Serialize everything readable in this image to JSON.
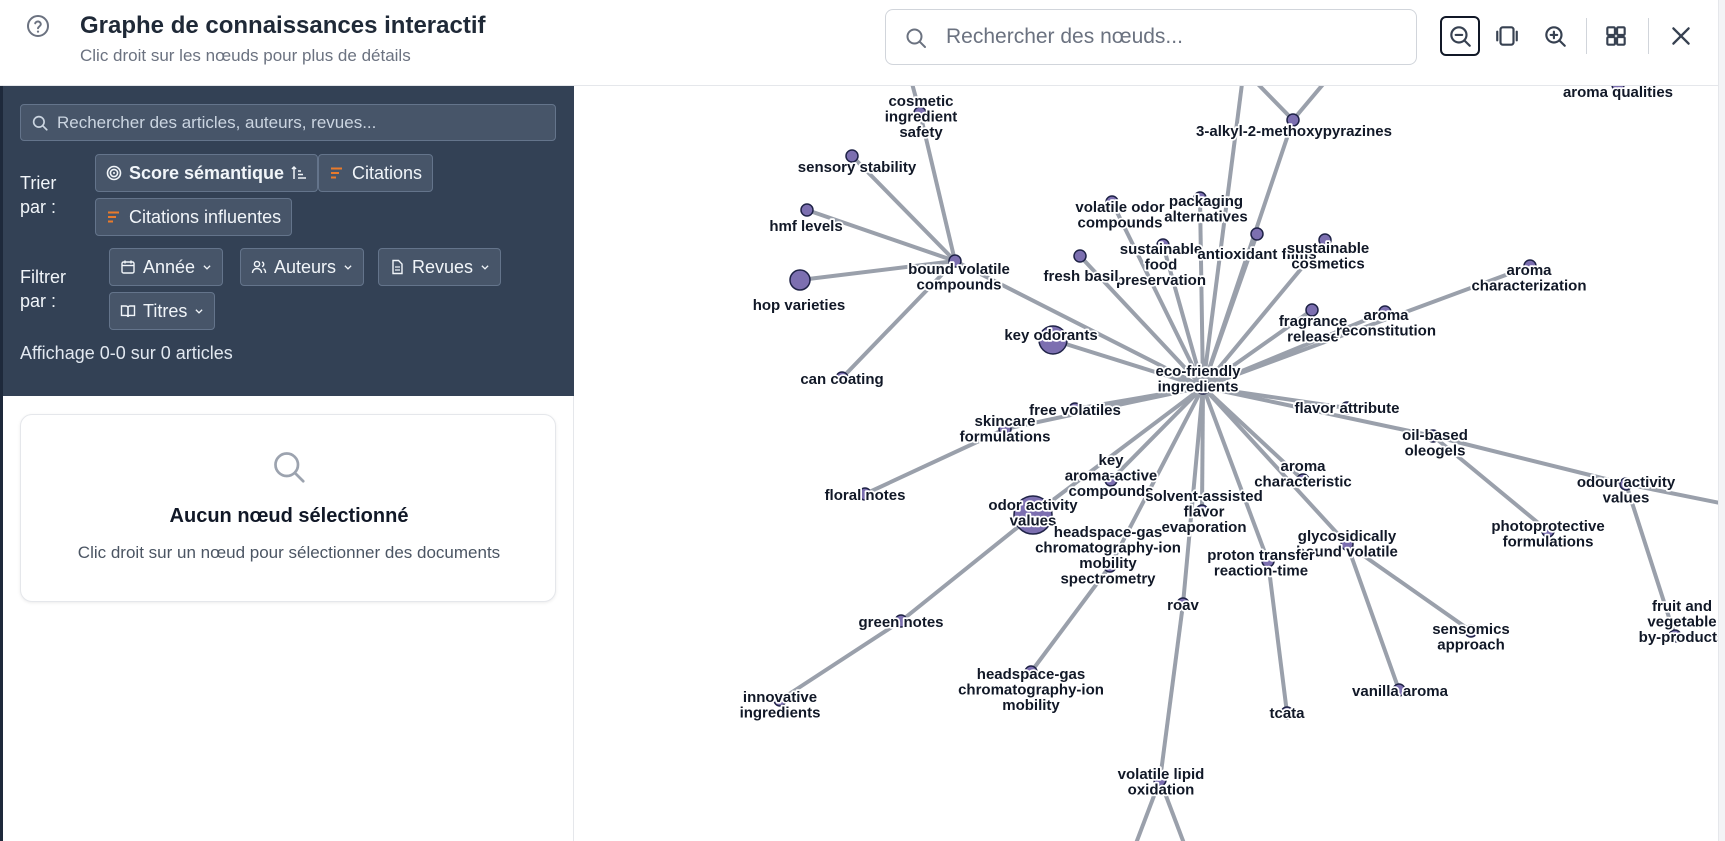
{
  "header": {
    "title": "Graphe de connaissances interactif",
    "subtitle": "Clic droit sur les nœuds pour plus de détails",
    "search_placeholder": "Rechercher des nœuds...",
    "tools": [
      "zoom-out-icon",
      "fit-view-icon",
      "zoom-in-icon",
      "layout-grid-icon",
      "close-icon"
    ]
  },
  "sidebar": {
    "search_placeholder": "Rechercher des articles, auteurs, revues...",
    "sort_label": "Trier par :",
    "sort_options": [
      "Score sémantique",
      "Citations",
      "Citations influentes"
    ],
    "filter_label": "Filtrer par :",
    "filter_options": [
      "Année",
      "Auteurs",
      "Revues",
      "Titres"
    ],
    "count_text": "Affichage 0-0 sur 0 articles"
  },
  "empty_state": {
    "title": "Aucun nœud sélectionné",
    "text": "Clic droit sur un nœud pour sélectionner des documents"
  },
  "colors": {
    "node_fill": "#7c6fb0",
    "node_stroke": "#1f2347",
    "edge": "#9aa0ab",
    "panel_dark": "#334155",
    "accent_orange": "#ea7a2b"
  },
  "graph": {
    "nodes": [
      {
        "id": "n0",
        "lines": [
          "eco-friendly",
          "ingredients"
        ]
      },
      {
        "id": "n1",
        "lines": [
          "cosmetic",
          "ingredient",
          "safety"
        ]
      },
      {
        "id": "n2",
        "lines": [
          "sensory stability"
        ]
      },
      {
        "id": "n3",
        "lines": [
          "hmf levels"
        ]
      },
      {
        "id": "n4",
        "lines": [
          "bound volatile",
          "compounds"
        ]
      },
      {
        "id": "n5",
        "lines": [
          "hop varieties"
        ]
      },
      {
        "id": "n6",
        "lines": [
          "can coating"
        ]
      },
      {
        "id": "n7",
        "lines": [
          "3-alkyl-2-methoxypyrazines"
        ]
      },
      {
        "id": "n8",
        "lines": [
          "aroma qualities"
        ]
      },
      {
        "id": "n9",
        "lines": [
          "volatile odor",
          "compounds"
        ]
      },
      {
        "id": "n10",
        "lines": [
          "packaging",
          "alternatives"
        ]
      },
      {
        "id": "n11",
        "lines": [
          "sustainable",
          "food",
          "preservation"
        ]
      },
      {
        "id": "n12",
        "lines": [
          "antioxidant films"
        ]
      },
      {
        "id": "n13",
        "lines": [
          "sustainable",
          "cosmetics"
        ]
      },
      {
        "id": "n14",
        "lines": [
          "fresh basil"
        ]
      },
      {
        "id": "n15",
        "lines": [
          "aroma",
          "characterization"
        ]
      },
      {
        "id": "n16",
        "lines": [
          "key odorants"
        ]
      },
      {
        "id": "n17",
        "lines": [
          "fragrance",
          "release"
        ]
      },
      {
        "id": "n18",
        "lines": [
          "aroma",
          "reconstitution"
        ]
      },
      {
        "id": "n19",
        "lines": [
          "free volatiles"
        ]
      },
      {
        "id": "n20",
        "lines": [
          "flavor attribute"
        ]
      },
      {
        "id": "n21",
        "lines": [
          "skincare",
          "formulations"
        ]
      },
      {
        "id": "n22",
        "lines": [
          "oil-based",
          "oleogels"
        ]
      },
      {
        "id": "n23",
        "lines": [
          "key",
          "aroma-active",
          "compounds"
        ]
      },
      {
        "id": "n24",
        "lines": [
          "aroma",
          "characteristic"
        ]
      },
      {
        "id": "n25",
        "lines": [
          "odour activity",
          "values"
        ]
      },
      {
        "id": "n26",
        "lines": [
          "floral notes"
        ]
      },
      {
        "id": "n27",
        "lines": [
          "odor activity",
          "values"
        ]
      },
      {
        "id": "n28",
        "lines": [
          "solvent-assisted",
          "flavor",
          "evaporation"
        ]
      },
      {
        "id": "n29",
        "lines": [
          "headspace-gas",
          "chromatography-ion",
          "mobility",
          "spectrometry"
        ]
      },
      {
        "id": "n30",
        "lines": [
          "glycosidically",
          "bound volatile"
        ]
      },
      {
        "id": "n31",
        "lines": [
          "proton transfer",
          "reaction-time"
        ]
      },
      {
        "id": "n32",
        "lines": [
          "photoprotective",
          "formulations"
        ]
      },
      {
        "id": "n33",
        "lines": [
          "roav"
        ]
      },
      {
        "id": "n34",
        "lines": [
          "green notes"
        ]
      },
      {
        "id": "n35",
        "lines": [
          "sensomics",
          "approach"
        ]
      },
      {
        "id": "n36",
        "lines": [
          "fruit and",
          "vegetable",
          "by-products"
        ]
      },
      {
        "id": "n37",
        "lines": [
          "headspace-gas",
          "chromatography-ion",
          "mobility"
        ]
      },
      {
        "id": "n38",
        "lines": [
          "vanilla aroma"
        ]
      },
      {
        "id": "n39",
        "lines": [
          "innovative",
          "ingredients"
        ]
      },
      {
        "id": "n40",
        "lines": [
          "tcata"
        ]
      },
      {
        "id": "n41",
        "lines": [
          "volatile lipid",
          "oxidation"
        ]
      }
    ]
  }
}
